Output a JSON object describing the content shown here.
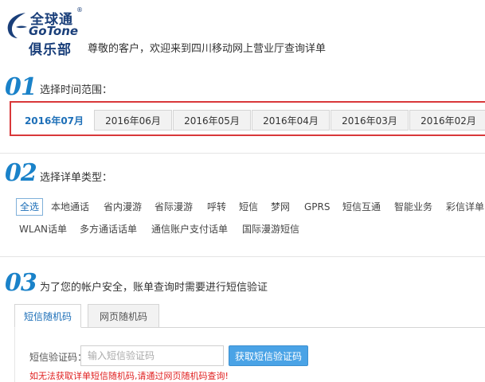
{
  "header": {
    "logo_cn": "全球通",
    "logo_reg": "®",
    "logo_en": "GoTone",
    "logo_club": "俱乐部",
    "welcome": "尊敬的客户，欢迎来到四川移动网上营业厅查询详单"
  },
  "section1": {
    "number": "01",
    "title": "选择时间范围：",
    "months": [
      "2016年07月",
      "2016年06月",
      "2016年05月",
      "2016年04月",
      "2016年03月",
      "2016年02月"
    ],
    "selected": "2016年07月"
  },
  "section2": {
    "number": "02",
    "title": "选择详单类型：",
    "types_row1": [
      "全选",
      "本地通话",
      "省内漫游",
      "省际漫游",
      "呼转",
      "短信",
      "梦网",
      "GPRS",
      "短信互通",
      "智能业务",
      "彩信详单"
    ],
    "types_row2": [
      "WLAN话单",
      "多方通话话单",
      "通信账户支付话单",
      "国际漫游短信"
    ],
    "selected": "全选"
  },
  "section3": {
    "number": "03",
    "title": "为了您的帐户安全，账单查询时需要进行短信验证",
    "tabs": [
      "短信随机码",
      "网页随机码"
    ],
    "active_tab": "短信随机码",
    "sms_label": "短信验证码：",
    "sms_placeholder": "输入短信验证码",
    "sms_value": "",
    "sms_button": "获取短信验证码",
    "warning": "如无法获取详单短信随机码,请通过网页随机码查询!"
  },
  "colors": {
    "brand_blue": "#1a82c9",
    "logo_navy": "#1a3f7a",
    "highlight_red": "#d9383a",
    "button_blue": "#4aa3e6",
    "warning_red": "#e02020"
  }
}
